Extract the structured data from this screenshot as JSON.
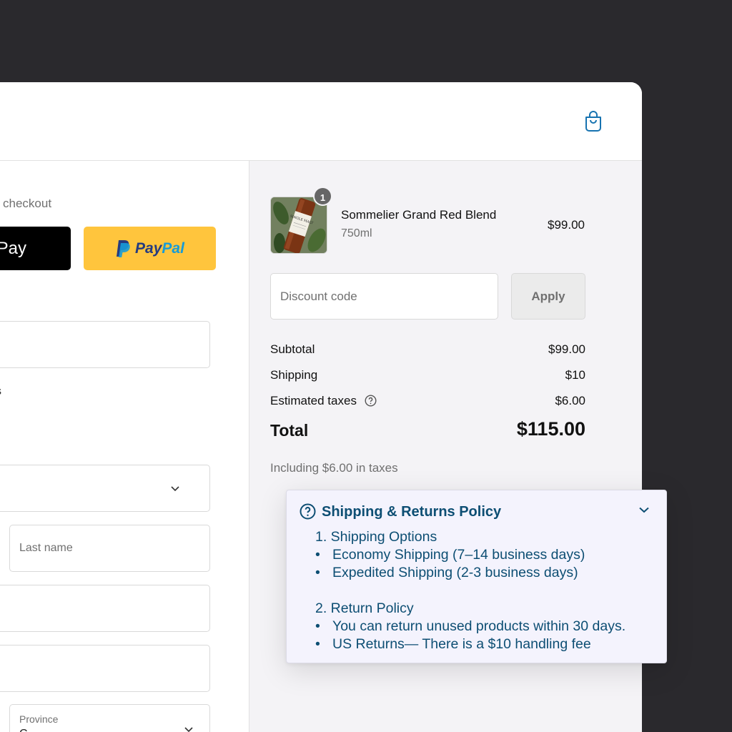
{
  "header": {
    "cart_icon": "shopping-bag-icon"
  },
  "left": {
    "express_checkout_label": "checkout",
    "apple_pay_label": "Pay",
    "paypal": {
      "pay": "Pay",
      "pal": "Pal"
    },
    "stray_text": "s",
    "last_name_placeholder": "Last name",
    "province_label": "Province",
    "province_value": "C"
  },
  "order": {
    "item": {
      "name": "Sommelier Grand Red Blend",
      "variant": "750ml",
      "price": "$99.00",
      "quantity": "1",
      "image_label": "SINGLE MALT"
    },
    "discount_placeholder": "Discount code",
    "apply_label": "Apply",
    "subtotal_label": "Subtotal",
    "subtotal_value": "$99.00",
    "shipping_label": "Shipping",
    "shipping_value": "$10",
    "taxes_label": "Estimated taxes",
    "taxes_value": "$6.00",
    "total_label": "Total",
    "total_value": "$115.00",
    "tax_note": "Including $6.00 in taxes"
  },
  "policy": {
    "title": "Shipping & Returns Policy",
    "section1": "1. Shipping Options",
    "section1_items": [
      "Economy Shipping (7–14 business days)",
      "Expedited Shipping (2-3 business days)"
    ],
    "section2": "2. Return Policy",
    "section2_items": [
      "You can return unused products within 30 days.",
      "US Returns— There is a $10 handling fee"
    ]
  },
  "colors": {
    "background": "#2a292d",
    "summary_bg": "#f4f3f6",
    "paypal_yellow": "#ffc53d",
    "policy_text": "#0d4e73",
    "policy_bg": "#f4f3fd",
    "accent_blue": "#1773b0"
  }
}
